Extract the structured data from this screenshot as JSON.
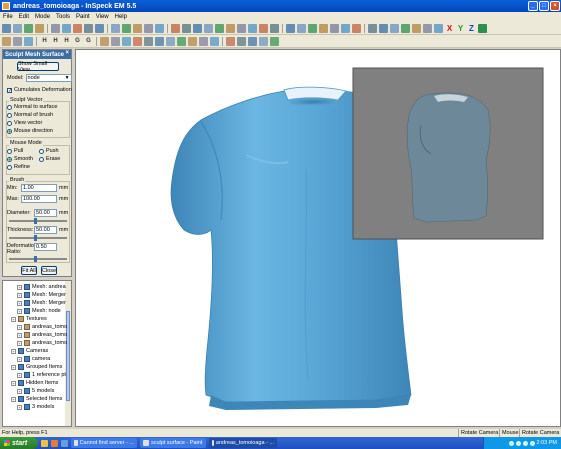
{
  "window": {
    "title": "andreas_tomoioaga - InSpeck EM 5.5"
  },
  "menu": [
    "File",
    "Edit",
    "Mode",
    "Tools",
    "Paint",
    "View",
    "Help"
  ],
  "toolbar1": {
    "letters": [
      "X",
      "Y",
      "Z"
    ],
    "letter_colors": [
      "#d01010",
      "#20a020",
      "#1040d0"
    ]
  },
  "toolbar2": {
    "letters": [
      "H",
      "H",
      "H",
      "G",
      "G"
    ]
  },
  "panel": {
    "title": "Sculpt Mesh Surface",
    "show_small_view": "Show Small View",
    "model_label": "Model:",
    "model_value": "node",
    "cumulates": "Cumulates Deformation",
    "sculpt_vector_label": "Sculpt Vector",
    "vector_options": [
      "Normal to surface",
      "Normal of brush",
      "View vector",
      "Mouse direction"
    ],
    "vector_selected": "Mouse direction",
    "mouse_mode_label": "Mouse Mode",
    "modes": [
      "Pull",
      "Push",
      "Smooth",
      "Erase",
      "Refine"
    ],
    "mode_selected": "Smooth",
    "brush_label": "Brush",
    "min_label": "Min:",
    "min_value": "1.00",
    "min_unit": "mm",
    "max_label": "Max:",
    "max_value": "100.00",
    "max_unit": "mm",
    "diameter_label": "Diameter:",
    "diameter_value": "50.00",
    "diameter_unit": "mm",
    "thickness_label": "Thickness:",
    "thickness_value": "50.00",
    "thickness_unit": "mm",
    "deformation_label": "Deformation Ratio:",
    "deformation_value": "0.50",
    "fit_all": "Fit All",
    "close": "Close"
  },
  "tree": {
    "items": [
      {
        "label": "Mesh: andrea",
        "indent": 2,
        "icon": "mesh"
      },
      {
        "label": "Mesh: Merger",
        "indent": 2,
        "icon": "mesh"
      },
      {
        "label": "Mesh: Merger",
        "indent": 2,
        "icon": "mesh"
      },
      {
        "label": "Mesh: node",
        "indent": 2,
        "icon": "mesh"
      },
      {
        "label": "Textures",
        "indent": 1,
        "icon": "tex"
      },
      {
        "label": "andreas_tomo",
        "indent": 2,
        "icon": "tex"
      },
      {
        "label": "andreas_tomo",
        "indent": 2,
        "icon": "tex"
      },
      {
        "label": "andreas_tomo",
        "indent": 2,
        "icon": "tex"
      },
      {
        "label": "Cameras",
        "indent": 1,
        "icon": "mesh"
      },
      {
        "label": "camera",
        "indent": 2,
        "icon": "mesh"
      },
      {
        "label": "Grouped Items",
        "indent": 1,
        "icon": "mesh"
      },
      {
        "label": "1 reference pt",
        "indent": 2,
        "icon": "mesh"
      },
      {
        "label": "Hidden Items",
        "indent": 1,
        "icon": "mesh"
      },
      {
        "label": "5 models",
        "indent": 2,
        "icon": "mesh"
      },
      {
        "label": "Selected Items",
        "indent": 1,
        "icon": "mesh"
      },
      {
        "label": "3 models",
        "indent": 2,
        "icon": "mesh"
      }
    ]
  },
  "status": {
    "help": "For Help, press F1",
    "rotate1": "Rotate Camera",
    "mouse": "Mouse",
    "rotate2": "Rotate Camera"
  },
  "taskbar": {
    "start": "start",
    "tasks": [
      "Cannot find server - ...",
      "sculpt surface - Paint",
      "andreas_tomoioaga - ..."
    ],
    "active_task": 2,
    "clock": "2:03 PM"
  },
  "colors": {
    "mesh": "#5aa7d6",
    "mesh_dark": "#3d86b8",
    "inset_bg": "#808080"
  }
}
